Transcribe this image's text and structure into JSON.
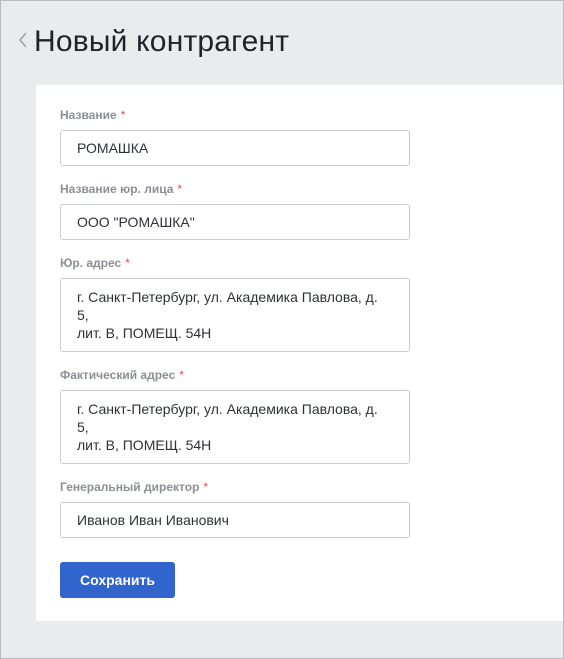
{
  "header": {
    "title": "Новый контрагент",
    "back_icon": "chevron-left-icon"
  },
  "form": {
    "required_mark": "*",
    "fields": [
      {
        "label": "Название",
        "value": "РОМАШКА"
      },
      {
        "label": "Название юр. лица",
        "value": "ООО \"РОМАШКА\""
      },
      {
        "label": "Юр. адрес",
        "value": "г. Санкт-Петербург, ул. Академика Павлова, д. 5,\nлит. В, ПОМЕЩ. 54Н"
      },
      {
        "label": "Фактический адрес",
        "value": "г. Санкт-Петербург, ул. Академика Павлова, д. 5,\nлит. В, ПОМЕЩ. 54Н"
      },
      {
        "label": "Генеральный директор",
        "value": "Иванов Иван Иванович"
      }
    ],
    "save_label": "Сохранить"
  },
  "colors": {
    "accent": "#3164cd",
    "background": "#eaebed",
    "required": "#d9534f"
  }
}
